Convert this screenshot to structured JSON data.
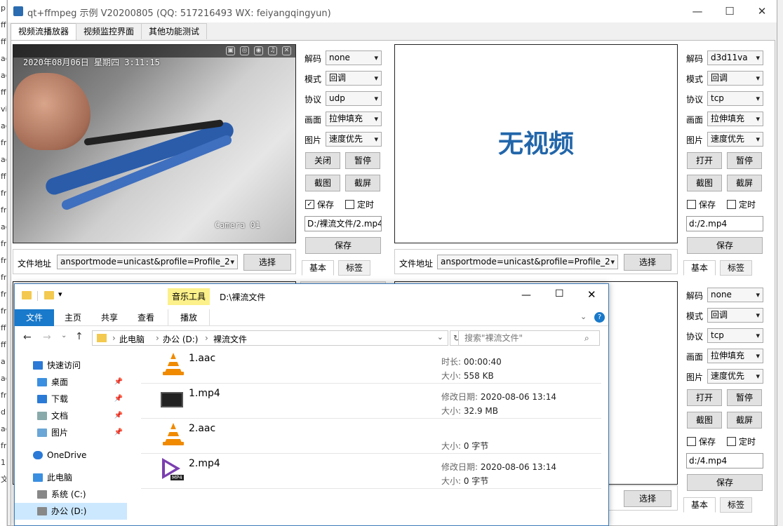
{
  "background_app": {
    "sliver_chars": [
      "p",
      "ff",
      "ff",
      "ac",
      "ac",
      "ff",
      "vi",
      "ac",
      "fr",
      "ac",
      "ff",
      "fr",
      "fr",
      "ac",
      "fr",
      "fr",
      "fr",
      "fr",
      "fr",
      "ff",
      "ff",
      "a",
      "ac",
      "fr",
      "d",
      "ac",
      "fr",
      "1",
      "文"
    ]
  },
  "window": {
    "title": "qt+ffmpeg 示例 V20200805 (QQ: 517216493 WX: feiyangqingyun)",
    "minimize": "—",
    "maximize": "☐",
    "close": "✕"
  },
  "tabs": [
    {
      "label": "视频流播放器",
      "active": true
    },
    {
      "label": "视频监控界面",
      "active": false
    },
    {
      "label": "其他功能测试",
      "active": false
    }
  ],
  "video1": {
    "date": "2020年08月06日 星期四  3:11:15",
    "camera": "Camera 01",
    "topbar_icons": [
      "▣",
      "◎",
      "◉",
      "♫",
      "✕"
    ]
  },
  "video2": {
    "no_video": "无视频"
  },
  "labels": {
    "decode": "解码",
    "mode": "模式",
    "protocol": "协议",
    "picture": "画面",
    "image": "图片",
    "file_addr": "文件地址",
    "select": "选择",
    "save": "保存",
    "record": "定时",
    "close": "关闭",
    "open": "打开",
    "pause": "暂停",
    "shot": "截图",
    "screen": "截屏",
    "tab_basic": "基本",
    "tab_tags": "标签"
  },
  "panel1": {
    "decode": "none",
    "mode": "回调",
    "protocol": "udp",
    "picture": "拉伸填充",
    "image": "速度优先",
    "toggle": "关闭",
    "save_checked": true,
    "record_checked": false,
    "path": "D:/裸流文件/2.mp4",
    "save_btn": "保存"
  },
  "panel2": {
    "decode": "d3d11va",
    "mode": "回调",
    "protocol": "tcp",
    "picture": "拉伸填充",
    "image": "速度优先",
    "toggle": "打开",
    "save_checked": false,
    "record_checked": false,
    "path": "d:/2.mp4",
    "save_btn": "保存"
  },
  "panel4": {
    "decode": "none",
    "mode": "回调",
    "protocol": "tcp",
    "picture": "拉伸填充",
    "image": "速度优先",
    "toggle": "打开",
    "save_checked": false,
    "record_checked": false,
    "path": "d:/4.mp4",
    "save_btn": "保存"
  },
  "addr1": "ansportmode=unicast&profile=Profile_2",
  "addr2": "ansportmode=unicast&profile=Profile_2",
  "explorer": {
    "path_title": "D:\\裸流文件",
    "music_tools": "音乐工具",
    "ribbon_tabs": {
      "file": "文件",
      "home": "主页",
      "share": "共享",
      "view": "查看",
      "play": "播放"
    },
    "breadcrumb": [
      "此电脑",
      "办公 (D:)",
      "裸流文件"
    ],
    "search_placeholder": "搜索\"裸流文件\"",
    "nav": [
      {
        "label": "快速访问",
        "icon": "star-icon",
        "pinned": false
      },
      {
        "label": "桌面",
        "icon": "desktop-icon",
        "pinned": true
      },
      {
        "label": "下载",
        "icon": "download-icon",
        "pinned": true
      },
      {
        "label": "文档",
        "icon": "document-icon",
        "pinned": true
      },
      {
        "label": "图片",
        "icon": "picture-icon",
        "pinned": true
      },
      {
        "label": "OneDrive",
        "icon": "cloud-icon",
        "pinned": false
      },
      {
        "label": "此电脑",
        "icon": "computer-icon",
        "pinned": false
      },
      {
        "label": "系统 (C:)",
        "icon": "drive-icon",
        "pinned": false
      },
      {
        "label": "办公 (D:)",
        "icon": "drive-icon",
        "pinned": false
      }
    ],
    "files": [
      {
        "name": "1.aac",
        "icon": "vlc-cone-icon",
        "meta1_label": "时长:",
        "meta1_value": "00:00:40",
        "meta2_label": "大小:",
        "meta2_value": "558 KB"
      },
      {
        "name": "1.mp4",
        "icon": "film-icon",
        "meta1_label": "修改日期:",
        "meta1_value": "2020-08-06 13:14",
        "meta2_label": "大小:",
        "meta2_value": "32.9 MB"
      },
      {
        "name": "2.aac",
        "icon": "vlc-cone-icon",
        "meta1_label": "",
        "meta1_value": "",
        "meta2_label": "大小:",
        "meta2_value": "0 字节"
      },
      {
        "name": "2.mp4",
        "icon": "play-icon",
        "meta1_label": "修改日期:",
        "meta1_value": "2020-08-06 13:14",
        "meta2_label": "大小:",
        "meta2_value": "0 字节"
      }
    ],
    "mp4_tag": "MP4"
  },
  "colors": {
    "accent": "#1979ca",
    "no_video": "#2266aa",
    "vlc": "#f08a00"
  }
}
